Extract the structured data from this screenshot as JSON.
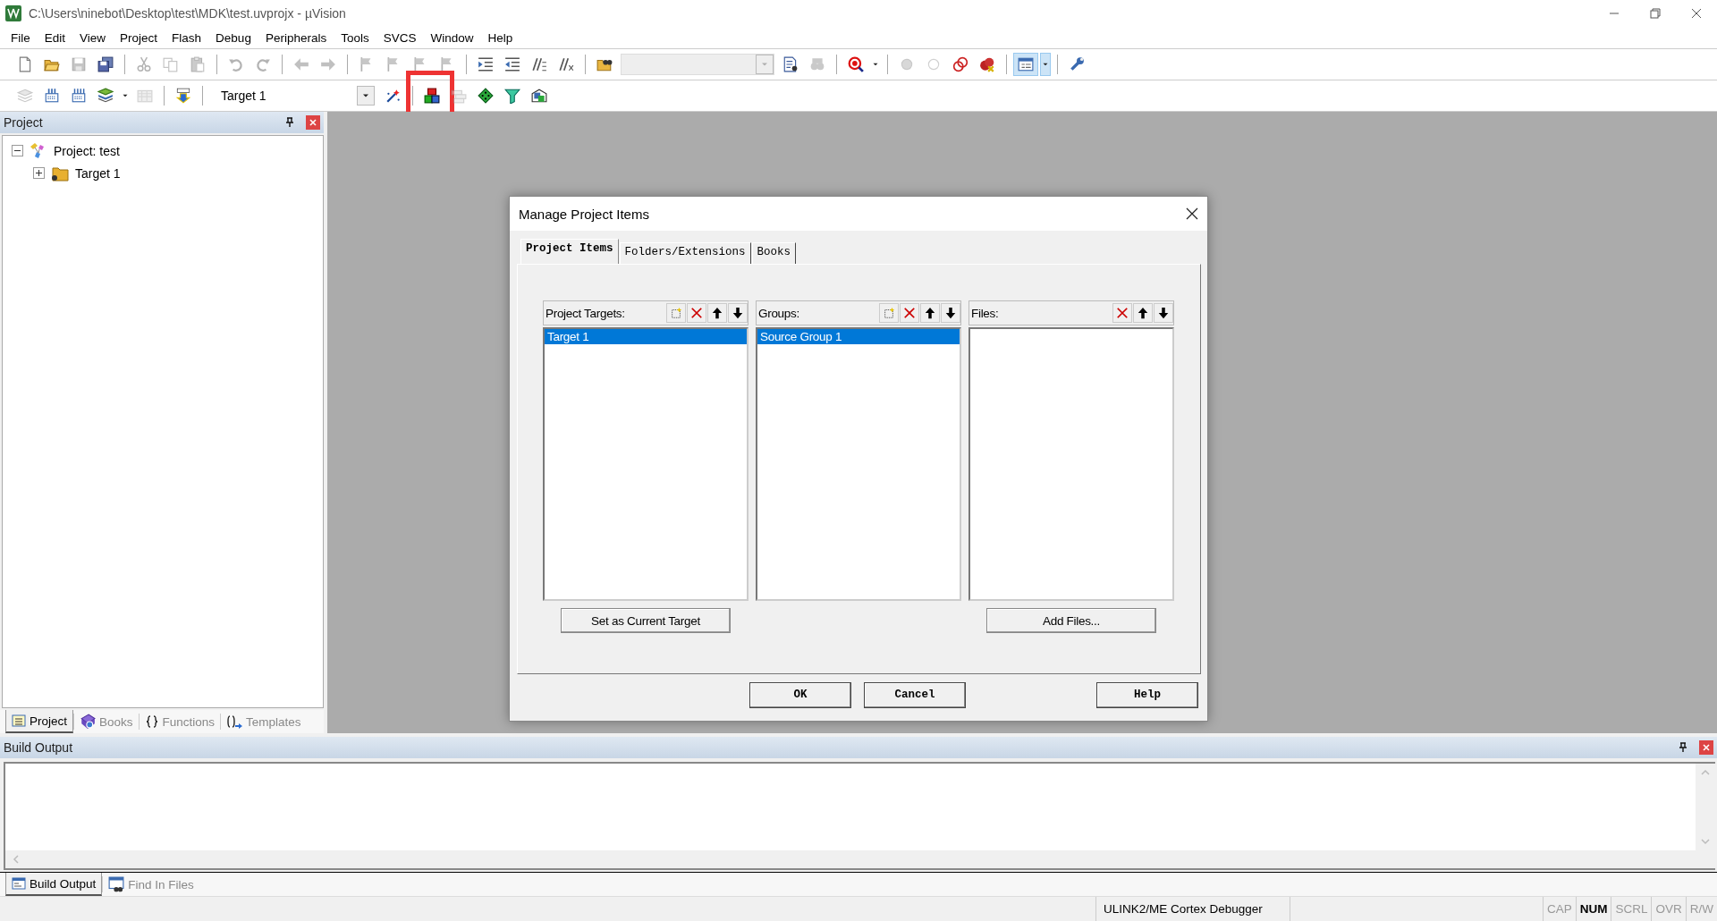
{
  "window": {
    "title": "C:\\Users\\ninebot\\Desktop\\test\\MDK\\test.uvprojx - µVision"
  },
  "menu": [
    "File",
    "Edit",
    "View",
    "Project",
    "Flash",
    "Debug",
    "Peripherals",
    "Tools",
    "SVCS",
    "Window",
    "Help"
  ],
  "toolbar_1": [
    {
      "kind": "new",
      "disabled": false
    },
    {
      "kind": "open",
      "disabled": false
    },
    {
      "kind": "save",
      "disabled": true
    },
    {
      "kind": "save_all",
      "disabled": false
    },
    {
      "kind": "separator"
    },
    {
      "kind": "cut",
      "disabled": true
    },
    {
      "kind": "copy",
      "disabled": true
    },
    {
      "kind": "paste",
      "disabled": true
    },
    {
      "kind": "separator"
    },
    {
      "kind": "undo",
      "disabled": true
    },
    {
      "kind": "redo",
      "disabled": true
    },
    {
      "kind": "separator"
    },
    {
      "kind": "back",
      "disabled": true
    },
    {
      "kind": "forward",
      "disabled": true
    },
    {
      "kind": "separator"
    },
    {
      "kind": "flag",
      "disabled": true
    },
    {
      "kind": "flag",
      "disabled": true
    },
    {
      "kind": "flag",
      "disabled": true
    },
    {
      "kind": "flag",
      "disabled": true
    },
    {
      "kind": "separator"
    },
    {
      "kind": "indent",
      "disabled": false
    },
    {
      "kind": "outdent",
      "disabled": false
    },
    {
      "kind": "comment",
      "disabled": false
    },
    {
      "kind": "uncomment",
      "disabled": false
    },
    {
      "kind": "separator"
    },
    {
      "kind": "find_files",
      "disabled": false
    },
    {
      "kind": "combo",
      "disabled": true
    },
    {
      "kind": "find",
      "disabled": false
    },
    {
      "kind": "incfind",
      "disabled": true
    },
    {
      "kind": "separator"
    },
    {
      "kind": "debug",
      "disabled": false
    },
    {
      "kind": "caret",
      "disabled": false
    },
    {
      "kind": "separator"
    },
    {
      "kind": "bp_dot",
      "disabled": true
    },
    {
      "kind": "bp_ring",
      "disabled": true
    },
    {
      "kind": "bp_rings",
      "disabled": false
    },
    {
      "kind": "bp_kill",
      "disabled": false
    },
    {
      "kind": "separator"
    },
    {
      "kind": "window",
      "disabled": false,
      "pressed": true
    },
    {
      "kind": "caret",
      "disabled": false,
      "pressed": true
    },
    {
      "kind": "separator"
    },
    {
      "kind": "wrench",
      "disabled": false
    }
  ],
  "toolbar_2": [
    {
      "kind": "translate",
      "disabled": true
    },
    {
      "kind": "build",
      "disabled": false
    },
    {
      "kind": "rebuild",
      "disabled": false
    },
    {
      "kind": "batch",
      "disabled": false
    },
    {
      "kind": "caret",
      "disabled": false
    },
    {
      "kind": "stop",
      "disabled": true
    },
    {
      "kind": "separator"
    },
    {
      "kind": "load",
      "disabled": false
    },
    {
      "kind": "separator"
    },
    {
      "kind": "target",
      "value": "Target 1"
    },
    {
      "kind": "wand",
      "disabled": false
    },
    {
      "kind": "separator"
    },
    {
      "kind": "blocks",
      "disabled": false,
      "highlighted": true
    },
    {
      "kind": "stack",
      "disabled": true
    },
    {
      "kind": "diamond",
      "disabled": false
    },
    {
      "kind": "funnel",
      "disabled": false
    },
    {
      "kind": "pack",
      "disabled": false
    }
  ],
  "project_panel": {
    "title": "Project",
    "tree": [
      {
        "label": "Project: test",
        "kind": "project",
        "expanded": true,
        "children": [
          {
            "label": "Target 1",
            "kind": "target",
            "expanded": false
          }
        ]
      }
    ],
    "tabs": [
      {
        "label": "Project",
        "kind": "project",
        "selected": true
      },
      {
        "label": "Books",
        "kind": "books",
        "selected": false
      },
      {
        "label": "Functions",
        "kind": "functions",
        "selected": false
      },
      {
        "label": "Templates",
        "kind": "templates",
        "selected": false
      }
    ]
  },
  "dialog": {
    "title": "Manage Project Items",
    "tabs": [
      {
        "label": "Project Items",
        "selected": true
      },
      {
        "label": "Folders/Extensions",
        "selected": false
      },
      {
        "label": "Books",
        "selected": false
      }
    ],
    "lists": [
      {
        "label": "Project Targets:",
        "can_add": true,
        "items": [
          {
            "label": "Target 1",
            "selected": true
          }
        ],
        "button": "Set as Current Target"
      },
      {
        "label": "Groups:",
        "can_add": true,
        "items": [
          {
            "label": "Source Group 1",
            "selected": true
          }
        ]
      },
      {
        "label": "Files:",
        "can_add": false,
        "button": "Add Files..."
      }
    ],
    "buttons": [
      "OK",
      "Cancel",
      "Help"
    ]
  },
  "output_panel": {
    "title": "Build Output",
    "tabs": [
      {
        "label": "Build Output",
        "kind": "output",
        "selected": true
      },
      {
        "label": "Find In Files",
        "kind": "find",
        "selected": false
      }
    ]
  },
  "status_bar": {
    "debugger": "ULINK2/ME Cortex Debugger",
    "indicators": [
      {
        "label": "CAP",
        "active": false
      },
      {
        "label": "NUM",
        "active": true
      },
      {
        "label": "SCRL",
        "active": false
      },
      {
        "label": "OVR",
        "active": false
      },
      {
        "label": "R/W",
        "active": false
      }
    ]
  }
}
